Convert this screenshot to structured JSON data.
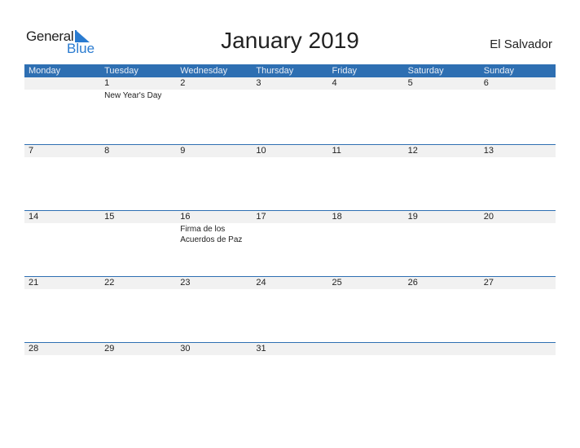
{
  "logo": {
    "word1": "General",
    "word2": "Blue"
  },
  "title": "January 2019",
  "country": "El Salvador",
  "colors": {
    "header_bg": "#2e6fb2",
    "strip_bg": "#f1f1f1",
    "accent": "#2a7bd0"
  },
  "weekdays": [
    "Monday",
    "Tuesday",
    "Wednesday",
    "Thursday",
    "Friday",
    "Saturday",
    "Sunday"
  ],
  "weeks": [
    {
      "days": [
        {
          "n": "",
          "ev": ""
        },
        {
          "n": "1",
          "ev": "New Year's Day"
        },
        {
          "n": "2",
          "ev": ""
        },
        {
          "n": "3",
          "ev": ""
        },
        {
          "n": "4",
          "ev": ""
        },
        {
          "n": "5",
          "ev": ""
        },
        {
          "n": "6",
          "ev": ""
        }
      ]
    },
    {
      "days": [
        {
          "n": "7",
          "ev": ""
        },
        {
          "n": "8",
          "ev": ""
        },
        {
          "n": "9",
          "ev": ""
        },
        {
          "n": "10",
          "ev": ""
        },
        {
          "n": "11",
          "ev": ""
        },
        {
          "n": "12",
          "ev": ""
        },
        {
          "n": "13",
          "ev": ""
        }
      ]
    },
    {
      "days": [
        {
          "n": "14",
          "ev": ""
        },
        {
          "n": "15",
          "ev": ""
        },
        {
          "n": "16",
          "ev": "Firma de los Acuerdos de Paz"
        },
        {
          "n": "17",
          "ev": ""
        },
        {
          "n": "18",
          "ev": ""
        },
        {
          "n": "19",
          "ev": ""
        },
        {
          "n": "20",
          "ev": ""
        }
      ]
    },
    {
      "days": [
        {
          "n": "21",
          "ev": ""
        },
        {
          "n": "22",
          "ev": ""
        },
        {
          "n": "23",
          "ev": ""
        },
        {
          "n": "24",
          "ev": ""
        },
        {
          "n": "25",
          "ev": ""
        },
        {
          "n": "26",
          "ev": ""
        },
        {
          "n": "27",
          "ev": ""
        }
      ]
    },
    {
      "days": [
        {
          "n": "28",
          "ev": ""
        },
        {
          "n": "29",
          "ev": ""
        },
        {
          "n": "30",
          "ev": ""
        },
        {
          "n": "31",
          "ev": ""
        },
        {
          "n": "",
          "ev": ""
        },
        {
          "n": "",
          "ev": ""
        },
        {
          "n": "",
          "ev": ""
        }
      ]
    }
  ]
}
